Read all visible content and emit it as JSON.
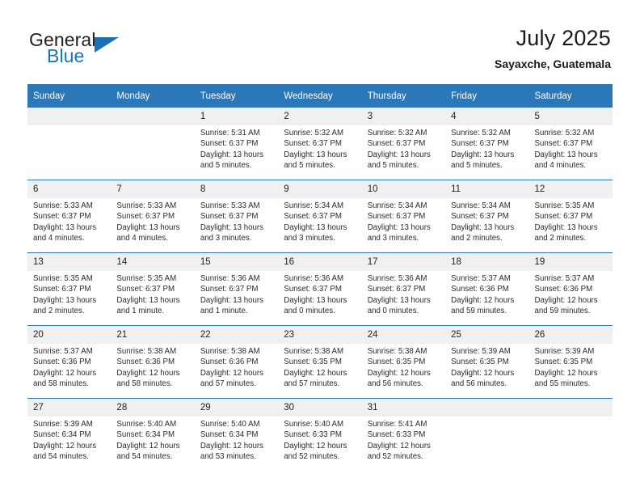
{
  "brand": {
    "name_part1": "General",
    "name_part2": "Blue",
    "logo_icon": "triangle-logo-icon"
  },
  "header": {
    "title": "July 2025",
    "subtitle": "Sayaxche, Guatemala"
  },
  "colors": {
    "header_blue": "#2b77b8",
    "brand_blue": "#1574bb",
    "daynum_band": "#f0f0f0",
    "text": "#2b2b2b"
  },
  "weekdays": [
    "Sunday",
    "Monday",
    "Tuesday",
    "Wednesday",
    "Thursday",
    "Friday",
    "Saturday"
  ],
  "labels": {
    "sunrise_prefix": "Sunrise:",
    "sunset_prefix": "Sunset:",
    "daylight_prefix": "Daylight:"
  },
  "weeks": [
    [
      {
        "day": "",
        "empty": true
      },
      {
        "day": "",
        "empty": true
      },
      {
        "day": "1",
        "sunrise": "Sunrise: 5:31 AM",
        "sunset": "Sunset: 6:37 PM",
        "daylight_l1": "Daylight: 13 hours",
        "daylight_l2": "and 5 minutes."
      },
      {
        "day": "2",
        "sunrise": "Sunrise: 5:32 AM",
        "sunset": "Sunset: 6:37 PM",
        "daylight_l1": "Daylight: 13 hours",
        "daylight_l2": "and 5 minutes."
      },
      {
        "day": "3",
        "sunrise": "Sunrise: 5:32 AM",
        "sunset": "Sunset: 6:37 PM",
        "daylight_l1": "Daylight: 13 hours",
        "daylight_l2": "and 5 minutes."
      },
      {
        "day": "4",
        "sunrise": "Sunrise: 5:32 AM",
        "sunset": "Sunset: 6:37 PM",
        "daylight_l1": "Daylight: 13 hours",
        "daylight_l2": "and 5 minutes."
      },
      {
        "day": "5",
        "sunrise": "Sunrise: 5:32 AM",
        "sunset": "Sunset: 6:37 PM",
        "daylight_l1": "Daylight: 13 hours",
        "daylight_l2": "and 4 minutes."
      }
    ],
    [
      {
        "day": "6",
        "sunrise": "Sunrise: 5:33 AM",
        "sunset": "Sunset: 6:37 PM",
        "daylight_l1": "Daylight: 13 hours",
        "daylight_l2": "and 4 minutes."
      },
      {
        "day": "7",
        "sunrise": "Sunrise: 5:33 AM",
        "sunset": "Sunset: 6:37 PM",
        "daylight_l1": "Daylight: 13 hours",
        "daylight_l2": "and 4 minutes."
      },
      {
        "day": "8",
        "sunrise": "Sunrise: 5:33 AM",
        "sunset": "Sunset: 6:37 PM",
        "daylight_l1": "Daylight: 13 hours",
        "daylight_l2": "and 3 minutes."
      },
      {
        "day": "9",
        "sunrise": "Sunrise: 5:34 AM",
        "sunset": "Sunset: 6:37 PM",
        "daylight_l1": "Daylight: 13 hours",
        "daylight_l2": "and 3 minutes."
      },
      {
        "day": "10",
        "sunrise": "Sunrise: 5:34 AM",
        "sunset": "Sunset: 6:37 PM",
        "daylight_l1": "Daylight: 13 hours",
        "daylight_l2": "and 3 minutes."
      },
      {
        "day": "11",
        "sunrise": "Sunrise: 5:34 AM",
        "sunset": "Sunset: 6:37 PM",
        "daylight_l1": "Daylight: 13 hours",
        "daylight_l2": "and 2 minutes."
      },
      {
        "day": "12",
        "sunrise": "Sunrise: 5:35 AM",
        "sunset": "Sunset: 6:37 PM",
        "daylight_l1": "Daylight: 13 hours",
        "daylight_l2": "and 2 minutes."
      }
    ],
    [
      {
        "day": "13",
        "sunrise": "Sunrise: 5:35 AM",
        "sunset": "Sunset: 6:37 PM",
        "daylight_l1": "Daylight: 13 hours",
        "daylight_l2": "and 2 minutes."
      },
      {
        "day": "14",
        "sunrise": "Sunrise: 5:35 AM",
        "sunset": "Sunset: 6:37 PM",
        "daylight_l1": "Daylight: 13 hours",
        "daylight_l2": "and 1 minute."
      },
      {
        "day": "15",
        "sunrise": "Sunrise: 5:36 AM",
        "sunset": "Sunset: 6:37 PM",
        "daylight_l1": "Daylight: 13 hours",
        "daylight_l2": "and 1 minute."
      },
      {
        "day": "16",
        "sunrise": "Sunrise: 5:36 AM",
        "sunset": "Sunset: 6:37 PM",
        "daylight_l1": "Daylight: 13 hours",
        "daylight_l2": "and 0 minutes."
      },
      {
        "day": "17",
        "sunrise": "Sunrise: 5:36 AM",
        "sunset": "Sunset: 6:37 PM",
        "daylight_l1": "Daylight: 13 hours",
        "daylight_l2": "and 0 minutes."
      },
      {
        "day": "18",
        "sunrise": "Sunrise: 5:37 AM",
        "sunset": "Sunset: 6:36 PM",
        "daylight_l1": "Daylight: 12 hours",
        "daylight_l2": "and 59 minutes."
      },
      {
        "day": "19",
        "sunrise": "Sunrise: 5:37 AM",
        "sunset": "Sunset: 6:36 PM",
        "daylight_l1": "Daylight: 12 hours",
        "daylight_l2": "and 59 minutes."
      }
    ],
    [
      {
        "day": "20",
        "sunrise": "Sunrise: 5:37 AM",
        "sunset": "Sunset: 6:36 PM",
        "daylight_l1": "Daylight: 12 hours",
        "daylight_l2": "and 58 minutes."
      },
      {
        "day": "21",
        "sunrise": "Sunrise: 5:38 AM",
        "sunset": "Sunset: 6:36 PM",
        "daylight_l1": "Daylight: 12 hours",
        "daylight_l2": "and 58 minutes."
      },
      {
        "day": "22",
        "sunrise": "Sunrise: 5:38 AM",
        "sunset": "Sunset: 6:36 PM",
        "daylight_l1": "Daylight: 12 hours",
        "daylight_l2": "and 57 minutes."
      },
      {
        "day": "23",
        "sunrise": "Sunrise: 5:38 AM",
        "sunset": "Sunset: 6:35 PM",
        "daylight_l1": "Daylight: 12 hours",
        "daylight_l2": "and 57 minutes."
      },
      {
        "day": "24",
        "sunrise": "Sunrise: 5:38 AM",
        "sunset": "Sunset: 6:35 PM",
        "daylight_l1": "Daylight: 12 hours",
        "daylight_l2": "and 56 minutes."
      },
      {
        "day": "25",
        "sunrise": "Sunrise: 5:39 AM",
        "sunset": "Sunset: 6:35 PM",
        "daylight_l1": "Daylight: 12 hours",
        "daylight_l2": "and 56 minutes."
      },
      {
        "day": "26",
        "sunrise": "Sunrise: 5:39 AM",
        "sunset": "Sunset: 6:35 PM",
        "daylight_l1": "Daylight: 12 hours",
        "daylight_l2": "and 55 minutes."
      }
    ],
    [
      {
        "day": "27",
        "sunrise": "Sunrise: 5:39 AM",
        "sunset": "Sunset: 6:34 PM",
        "daylight_l1": "Daylight: 12 hours",
        "daylight_l2": "and 54 minutes."
      },
      {
        "day": "28",
        "sunrise": "Sunrise: 5:40 AM",
        "sunset": "Sunset: 6:34 PM",
        "daylight_l1": "Daylight: 12 hours",
        "daylight_l2": "and 54 minutes."
      },
      {
        "day": "29",
        "sunrise": "Sunrise: 5:40 AM",
        "sunset": "Sunset: 6:34 PM",
        "daylight_l1": "Daylight: 12 hours",
        "daylight_l2": "and 53 minutes."
      },
      {
        "day": "30",
        "sunrise": "Sunrise: 5:40 AM",
        "sunset": "Sunset: 6:33 PM",
        "daylight_l1": "Daylight: 12 hours",
        "daylight_l2": "and 52 minutes."
      },
      {
        "day": "31",
        "sunrise": "Sunrise: 5:41 AM",
        "sunset": "Sunset: 6:33 PM",
        "daylight_l1": "Daylight: 12 hours",
        "daylight_l2": "and 52 minutes."
      },
      {
        "day": "",
        "empty": true
      },
      {
        "day": "",
        "empty": true
      }
    ]
  ]
}
